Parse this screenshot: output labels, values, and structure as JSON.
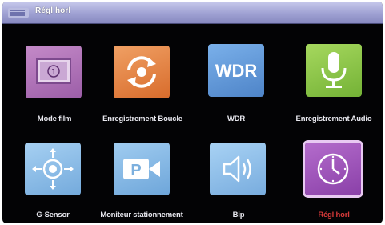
{
  "window": {
    "title": "Régl horl"
  },
  "menu": {
    "items": [
      {
        "label": "Mode film",
        "icon": "film-mode-icon"
      },
      {
        "label": "Enregistrement Boucle",
        "icon": "loop-recording-icon"
      },
      {
        "label": "WDR",
        "icon": "wdr-icon",
        "icon_text": "WDR"
      },
      {
        "label": "Enregistrement Audio",
        "icon": "microphone-icon"
      },
      {
        "label": "G-Sensor",
        "icon": "g-sensor-icon"
      },
      {
        "label": "Moniteur stationnement",
        "icon": "parking-monitor-icon",
        "icon_text": "P"
      },
      {
        "label": "Bip",
        "icon": "speaker-icon"
      },
      {
        "label": "Régl horl",
        "icon": "clock-icon",
        "selected": true
      }
    ]
  },
  "colors": {
    "selected_label": "#d83a3a",
    "title_bar": "#9fa1d3"
  }
}
